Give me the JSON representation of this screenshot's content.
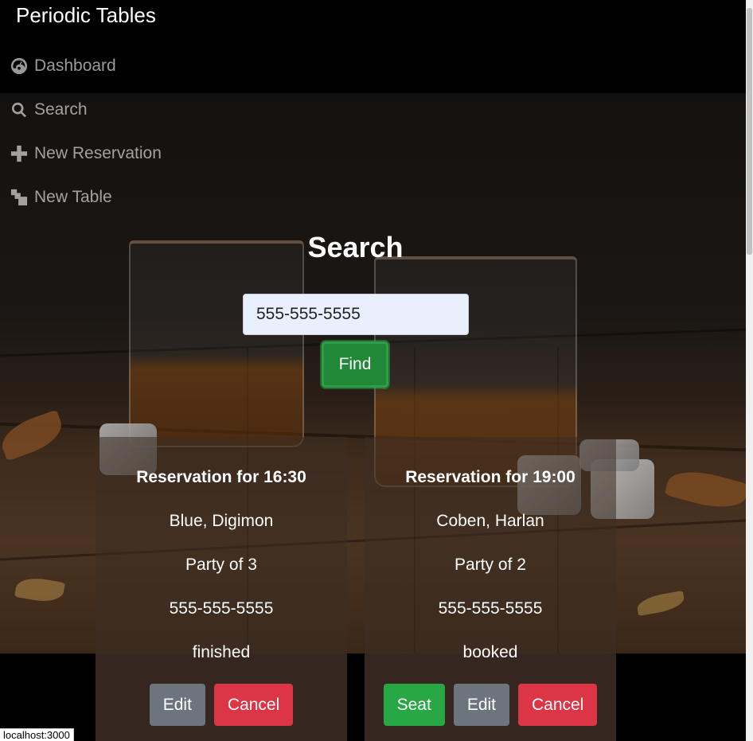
{
  "app": {
    "title": "Periodic Tables"
  },
  "nav": {
    "items": [
      {
        "label": "Dashboard",
        "icon": "dashboard-icon"
      },
      {
        "label": "Search",
        "icon": "search-icon"
      },
      {
        "label": "New Reservation",
        "icon": "plus-icon"
      },
      {
        "label": "New Table",
        "icon": "table-icon"
      }
    ]
  },
  "search": {
    "title": "Search",
    "value": "555-555-5555",
    "find_label": "Find"
  },
  "reservations": [
    {
      "heading": "Reservation for 16:30",
      "name": "Blue, Digimon",
      "party": "Party of 3",
      "phone": "555-555-5555",
      "status": "finished",
      "edit_label": "Edit",
      "cancel_label": "Cancel"
    },
    {
      "heading": "Reservation for 19:00",
      "name": "Coben, Harlan",
      "party": "Party of 2",
      "phone": "555-555-5555",
      "status": "booked",
      "seat_label": "Seat",
      "edit_label": "Edit",
      "cancel_label": "Cancel"
    }
  ],
  "status_bar": {
    "url": "localhost:3000"
  },
  "colors": {
    "success": "#28a745",
    "danger": "#dc3545",
    "secondary": "#6c757d",
    "input_bg": "#e8f0fe"
  }
}
